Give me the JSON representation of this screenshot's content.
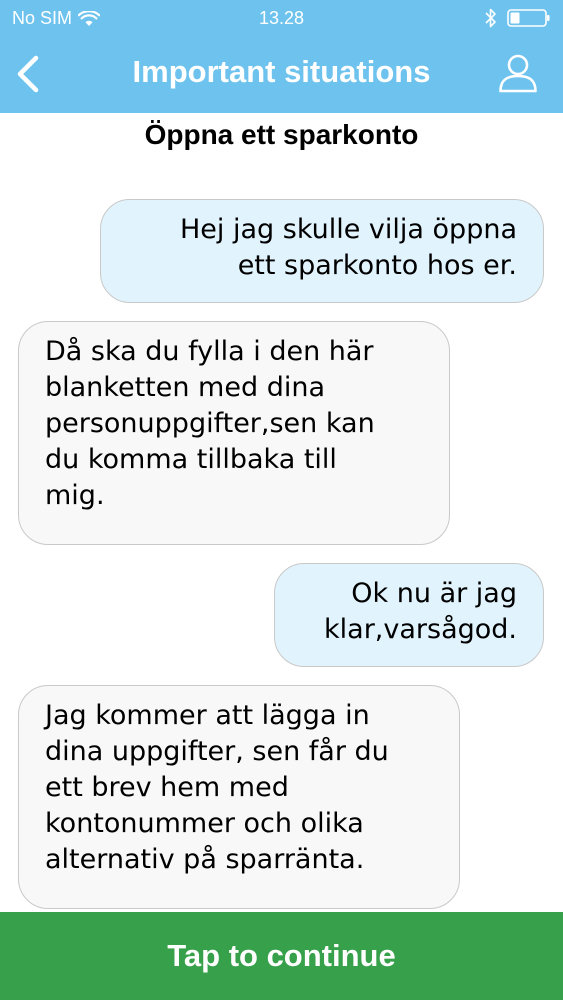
{
  "status_bar": {
    "carrier": "No SIM",
    "time": "13.28",
    "icons": [
      "wifi-icon",
      "bluetooth-icon",
      "battery-icon"
    ]
  },
  "nav": {
    "title": "Important situations",
    "back_icon": "chevron-left-icon",
    "profile_icon": "user-icon"
  },
  "conversation": {
    "title": "Öppna ett sparkonto",
    "messages": [
      {
        "side": "sent",
        "text": "Hej jag skulle vilja öppna\nett sparkonto hos er."
      },
      {
        "side": "received",
        "text": "Då ska du fylla i den här\nblanketten med dina\npersonuppgifter,sen kan\ndu komma tillbaka till\nmig."
      },
      {
        "side": "sent",
        "text": "Ok nu är jag\nklar,varsågod."
      },
      {
        "side": "received",
        "text": "Jag kommer att lägga in\ndina uppgifter, sen får du\nett brev hem med\nkontonummer och olika\nalternativ på sparränta."
      }
    ]
  },
  "footer": {
    "continue_label": "Tap to continue"
  },
  "colors": {
    "header": "#6ec3ee",
    "sent_bubble": "#e1f3fc",
    "received_bubble": "#f8f8f8",
    "bubble_border": "#c9c9c9",
    "continue_button": "#36a14a"
  }
}
